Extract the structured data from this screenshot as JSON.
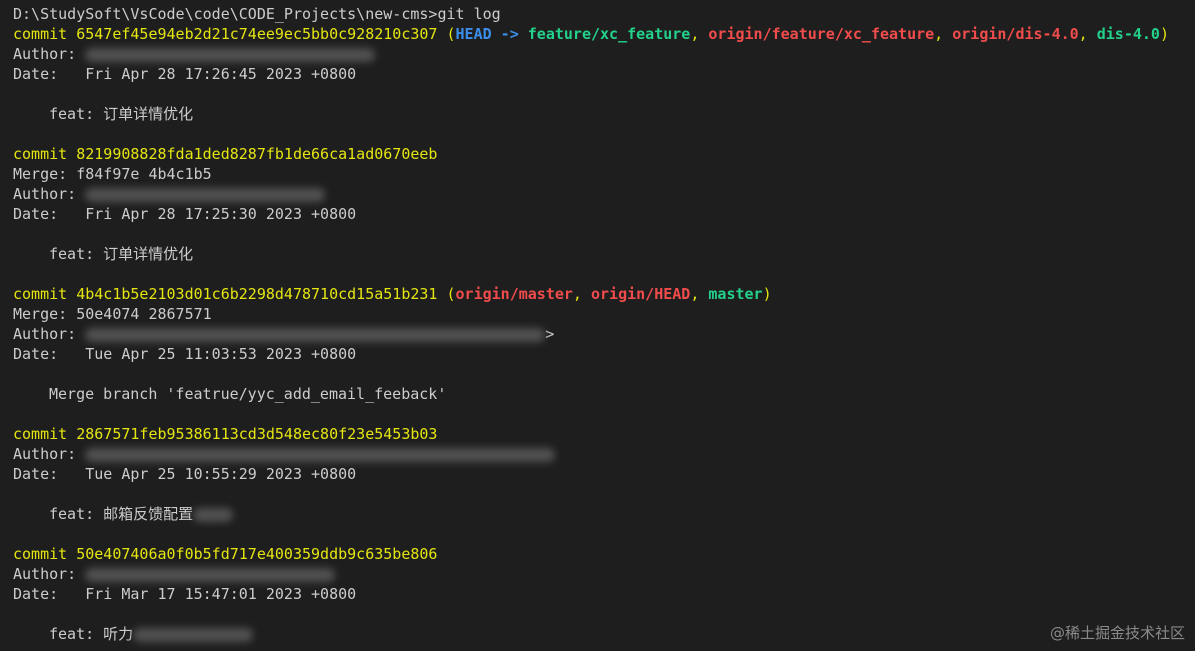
{
  "terminal": {
    "prompt": "D:\\StudySoft\\VsCode\\code\\CODE_Projects\\new-cms>git log"
  },
  "commits": [
    {
      "hash_line": "commit 6547ef45e94eb2d21c74ee9ec5bb0c928210c307",
      "refs": {
        "open": " (",
        "head": "HEAD -> ",
        "branch": "feature/xc_feature",
        "sep1": ", ",
        "remote1": "origin/feature/xc_feature",
        "sep2": ", ",
        "remote2": "origin/dis-4.0",
        "sep3": ", ",
        "tag": "dis-4.0",
        "close": ")"
      },
      "author_label": "Author: ",
      "date": "Date:   Fri Apr 28 17:26:45 2023 +0800",
      "message": "feat: 订单详情优化"
    },
    {
      "hash_line": "commit 8219908828fda1ded8287fb1de66ca1ad0670eeb",
      "merge": "Merge: f84f97e 4b4c1b5",
      "author_label": "Author: ",
      "date": "Date:   Fri Apr 28 17:25:30 2023 +0800",
      "message": "feat: 订单详情优化"
    },
    {
      "hash_line": "commit 4b4c1b5e2103d01c6b2298d478710cd15a51b231",
      "refs": {
        "open": " (",
        "remote1": "origin/master",
        "sep1": ", ",
        "remote2": "origin/HEAD",
        "sep2": ", ",
        "branch": "master",
        "close": ")"
      },
      "merge": "Merge: 50e4074 2867571",
      "author_label": "Author: ",
      "author_tail": ">",
      "date": "Date:   Tue Apr 25 11:03:53 2023 +0800",
      "message": "Merge branch 'featrue/yyc_add_email_feeback'"
    },
    {
      "hash_line": "commit 2867571feb95386113cd3d548ec80f23e5453b03",
      "author_label": "Author: ",
      "date": "Date:   Tue Apr 25 10:55:29 2023 +0800",
      "message": "feat: 邮箱反馈配置"
    },
    {
      "hash_line": "commit 50e407406a0f0b5fd717e400359ddb9c635be806",
      "author_label": "Author: ",
      "date": "Date:   Fri Mar 17 15:47:01 2023 +0800",
      "message": "feat: 听力"
    }
  ],
  "watermark": "@稀土掘金技术社区",
  "colors": {
    "background": "#1e1e1e",
    "commit_hash": "#e5e510",
    "head_ref": "#3b8eea",
    "local_branch": "#23d18b",
    "remote_branch": "#f14c4c"
  }
}
